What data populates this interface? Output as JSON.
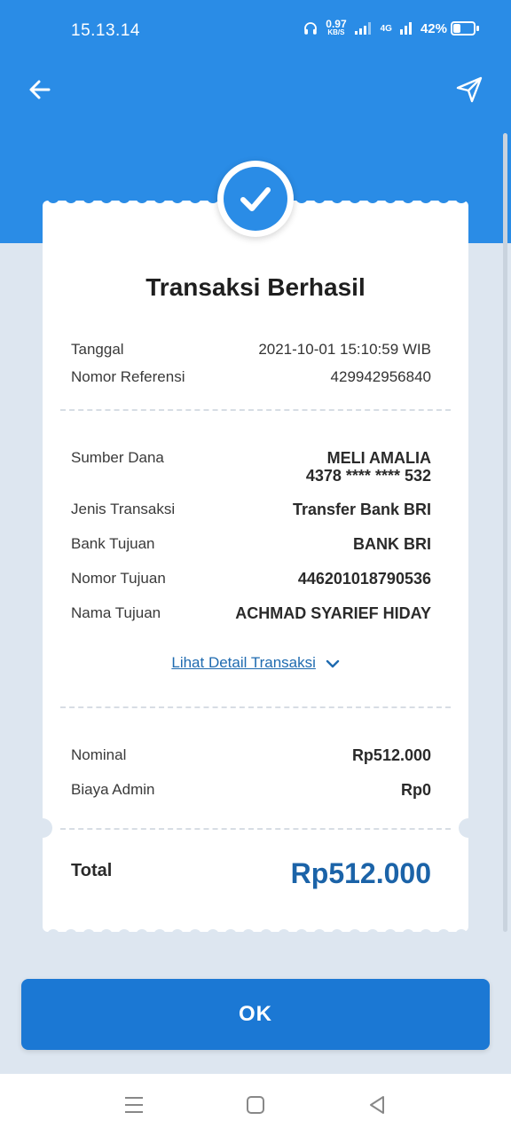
{
  "status": {
    "time": "15.13.14",
    "speed_value": "0.97",
    "speed_unit": "KB/S",
    "network": "4G",
    "battery": "42%",
    "battery_level": 0.42
  },
  "header": {
    "back_icon": "arrow-left-icon",
    "share_icon": "send-icon"
  },
  "receipt": {
    "title": "Transaksi Berhasil",
    "date_label": "Tanggal",
    "date_value": "2021-10-01 15:10:59 WIB",
    "ref_label": "Nomor Referensi",
    "ref_value": "429942956840",
    "source_label": "Sumber Dana",
    "source_name": "MELI AMALIA",
    "source_account": "4378 **** **** 532",
    "type_label": "Jenis Transaksi",
    "type_value": "Transfer Bank BRI",
    "bank_label": "Bank Tujuan",
    "bank_value": "BANK BRI",
    "dest_no_label": "Nomor Tujuan",
    "dest_no_value": "446201018790536",
    "dest_name_label": "Nama Tujuan",
    "dest_name_value": "ACHMAD SYARIEF HIDAY",
    "detail_link": "Lihat Detail Transaksi",
    "nominal_label": "Nominal",
    "nominal_value": "Rp512.000",
    "admin_label": "Biaya Admin",
    "admin_value": "Rp0",
    "total_label": "Total",
    "total_value": "Rp512.000"
  },
  "actions": {
    "ok_label": "OK"
  },
  "colors": {
    "primary": "#2a8ce6",
    "button": "#1b78d4",
    "total": "#1b63a8",
    "background": "#dde6f0"
  }
}
